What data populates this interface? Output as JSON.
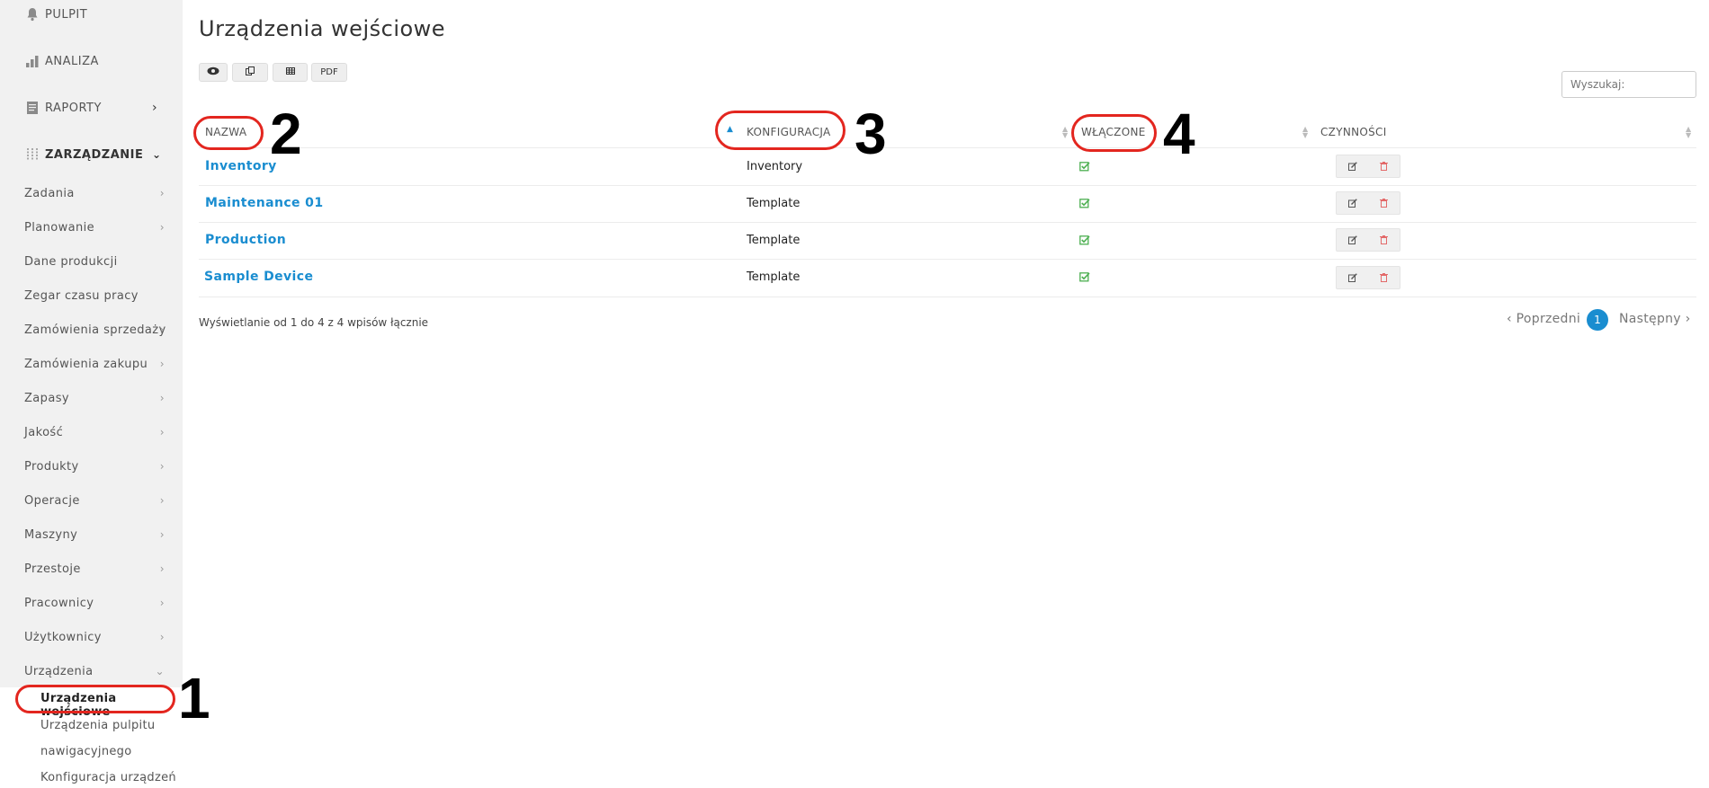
{
  "sidebar": {
    "top": [
      {
        "label": "PULPIT",
        "icon": "bell-icon"
      },
      {
        "label": "ANALIZA",
        "icon": "bar-chart-icon"
      },
      {
        "label": "RAPORTY",
        "icon": "report-icon"
      },
      {
        "label": "ZARZĄDZANIE",
        "icon": "sliders-icon"
      }
    ],
    "items": [
      "Zadania",
      "Planowanie",
      "Dane produkcji",
      "Zegar czasu pracy",
      "Zamówienia sprzedaży",
      "Zamówienia zakupu",
      "Zapasy",
      "Jakość",
      "Produkty",
      "Operacje",
      "Maszyny",
      "Przestoje",
      "Pracownicy",
      "Użytkownicy",
      "Urządzenia"
    ],
    "subitems": [
      "Urządzenia wejściowe",
      "Urządzenia pulpitu",
      "nawigacyjnego",
      "Konfiguracja urządzeń"
    ]
  },
  "page": {
    "title": "Urządzenia wejściowe",
    "toolbar": {
      "pdf_label": "PDF"
    },
    "search_placeholder": "Wyszukaj:"
  },
  "table": {
    "headers": [
      "NAZWA",
      "KONFIGURACJA",
      "WŁĄCZONE",
      "CZYNNOŚCI"
    ],
    "rows": [
      {
        "name": "Inventory",
        "config": "Inventory",
        "enabled": true
      },
      {
        "name": "Maintenance 01",
        "config": "Template",
        "enabled": true
      },
      {
        "name": "Production",
        "config": "Template",
        "enabled": true
      },
      {
        "name": "Sample Device",
        "config": "Template",
        "enabled": true
      }
    ]
  },
  "footer": {
    "info": "Wyświetlanie od 1 do 4 z 4 wpisów łącznie",
    "prev": "‹ Poprzedni",
    "page": "1",
    "next": "Następny ›"
  },
  "annotations": [
    "1",
    "2",
    "3",
    "4"
  ],
  "colors": {
    "accent": "#1a8dd0",
    "highlight": "#e3261f",
    "check": "#4caf50",
    "delete": "#e36a6a"
  }
}
